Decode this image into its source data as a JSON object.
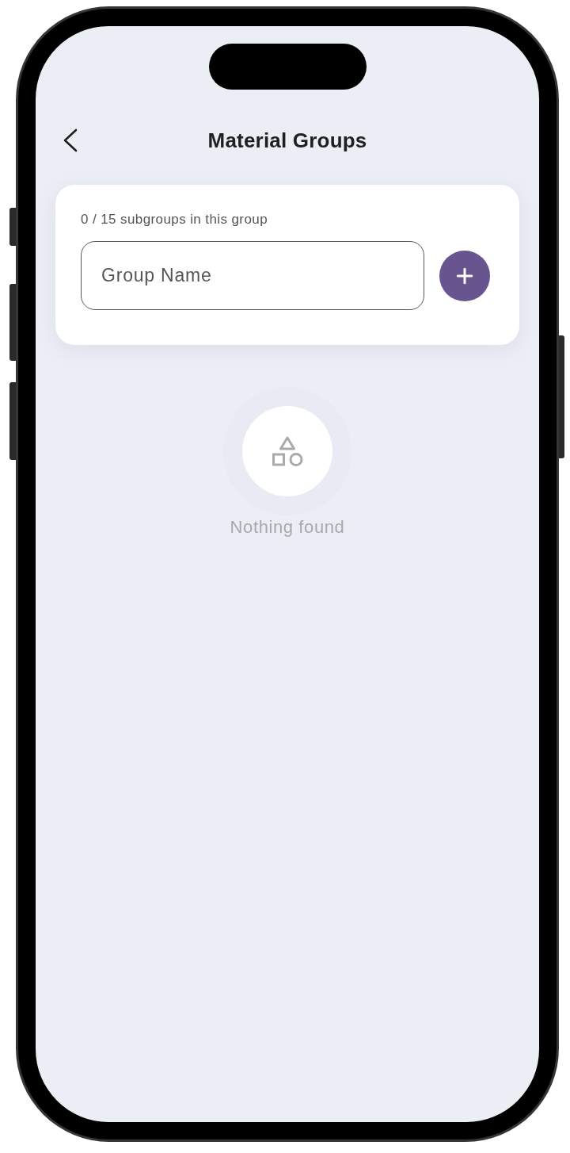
{
  "header": {
    "title": "Material Groups"
  },
  "group_form": {
    "counter": "0 / 15 subgroups in this group",
    "name_field": {
      "placeholder": "Group Name"
    }
  },
  "empty_state": {
    "message": "Nothing found"
  }
}
